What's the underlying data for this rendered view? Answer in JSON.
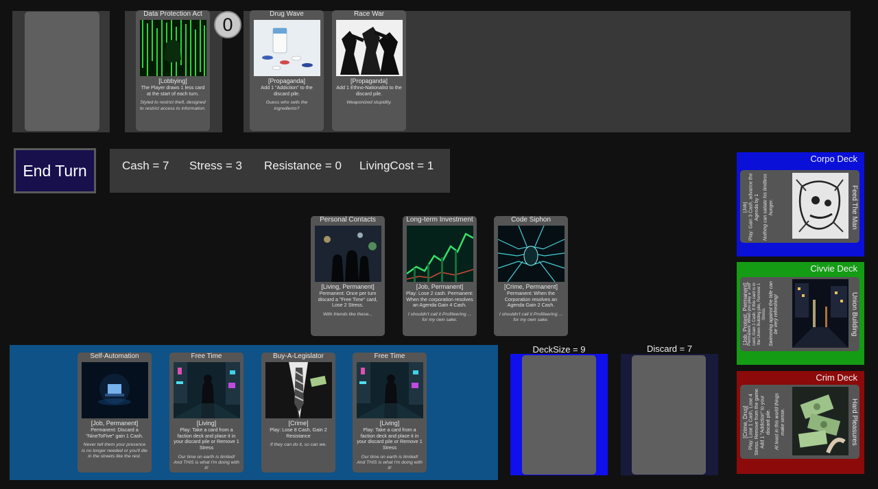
{
  "colors": {
    "hand_area": "#0e5287",
    "deck_pile": "#1010ee",
    "corpo": "#0a10d8",
    "civvie": "#149c14",
    "crim": "#8c0a0a",
    "end_turn": "#17104d"
  },
  "agenda": {
    "counter": "0",
    "card": {
      "title": "Data Protection Act",
      "type": "[Lobbying]",
      "text": "The Player draws 1 less card at the start of each turn.",
      "flavor": "Styled to restrict theft, designed to restrict access to information."
    }
  },
  "discard_queue": [
    {
      "title": "Drug Wave",
      "type": "[Propaganda]",
      "text": "Add 1 \"Addiction\" to the discard pile.",
      "flavor": "Guess who sells the ingredients?"
    },
    {
      "title": "Race War",
      "type": "[Propaganda]",
      "text": "Add 1 Ethno-Nationalist to the discard pile.",
      "flavor": "Weaponized stupidity."
    }
  ],
  "end_turn_label": "End Turn",
  "stats": {
    "cash": "Cash = 7",
    "stress": "Stress = 3",
    "resistance": "Resistance = 0",
    "living_cost": "LivingCost = 1"
  },
  "permanents": [
    {
      "title": "Personal Contacts",
      "type": "[Living, Permanent]",
      "text": "Permanent: Once per turn discard a \"Free Time\" card, Lose 2 Stress.",
      "flavor": "With friends like these..."
    },
    {
      "title": "Long-term Investment",
      "type": "[Job, Permanent]",
      "text": "Play: Lose 2 cash. Permanent: When the corporation resolves an Agenda Gain 4 Cash.",
      "flavor": "I shouldn't call it Profiteering ... for my own sake."
    },
    {
      "title": "Code Siphon",
      "type": "[Crime, Permanent]",
      "text": "Permanent: When the Corporation resolves an Agenda Gain 2 Cash.",
      "flavor": "I shouldn't call it Profiteering ... for my own sake."
    }
  ],
  "hand": [
    {
      "title": "Self-Automation",
      "type": "[Job, Permanent]",
      "text": "Permanent: Discard a \"NineToFive\" gain 1 Cash.",
      "flavor": "Never tell them your presence is no longer needed or you'll die in the streets like the rest."
    },
    {
      "title": "Free Time",
      "type": "[Living]",
      "text": "Play: Take a card from a faction deck and place it in your discard pile or Remove 1 Stress",
      "flavor": "Our time on earth is limited! And THIS is what I'm doing with it!"
    },
    {
      "title": "Buy-A-Legislator",
      "type": "[Crime]",
      "text": "Play: Lose 8 Cash, Gain 2 Resistance",
      "flavor": "If they can do it, so can we."
    },
    {
      "title": "Free Time",
      "type": "[Living]",
      "text": "Play: Take a card from a faction deck and place it in your discard pile or Remove 1 Stress",
      "flavor": "Our time on earth is limited! And THIS is what I'm doing with it!"
    }
  ],
  "deck_size_label": "DeckSize = 9",
  "discard_label": "Discard = 7",
  "faction_decks": {
    "corpo": {
      "title": "Corpo Deck",
      "card": {
        "title": "Feed The Man",
        "type": "[Job]",
        "text": "Play: Gain 3 Cash, advance the Agenda by 1",
        "flavor": "Nothing can satiate his limitless hunger."
      }
    },
    "civvie": {
      "title": "Civvie Deck",
      "card": {
        "title": "Union Building",
        "type": "[Job, Protest, Permanent]",
        "text": "Permanent: When you play a \"Job\" card, Gain 1 Cash. If this card is in the Union Building pile, Remove 1 Stress.",
        "flavor": "Swimming against the tide can be very refreshing!"
      }
    },
    "crim": {
      "title": "Crim Deck",
      "card": {
        "title": "Hard Pleasures",
        "type": "[Crime, Drug]",
        "text": "Play: Lose 1 Cash, Lose 4 Stress. Remove from the game. Add 1 \"Addiction\" to your discard pile.",
        "flavor": "At least in this world things make sense."
      }
    }
  }
}
